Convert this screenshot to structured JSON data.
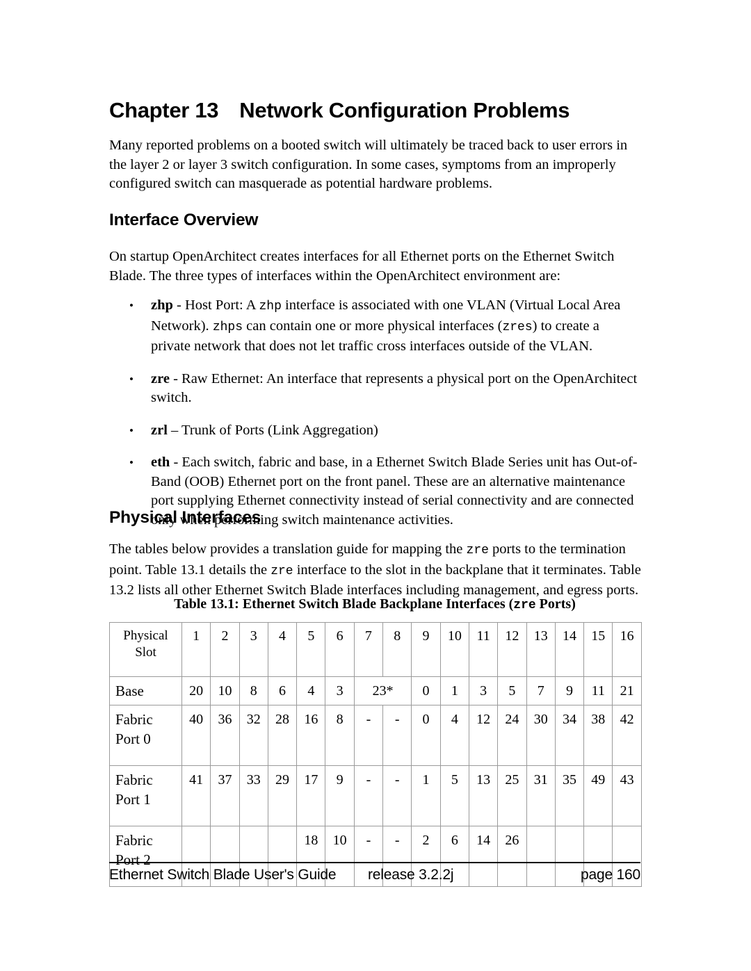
{
  "document": {
    "chapter_number": "Chapter 13",
    "chapter_title": "Network Configuration Problems",
    "intro_paragraph": "Many reported problems on a booted switch will ultimately be traced back to user errors in the layer 2 or layer 3 switch configuration. In some cases, symptoms from an improperly configured switch can masquerade as potential hardware problems."
  },
  "sections": {
    "interface_overview": {
      "heading": "Interface Overview",
      "paragraph": "On startup OpenArchitect creates interfaces for all Ethernet ports on the Ethernet Switch Blade. The three types of interfaces within the OpenArchitect environment are:",
      "bullets": [
        {
          "marker": "•",
          "term": "zhp",
          "separator": " - ",
          "text_1": "Host Port: A ",
          "mono_1": "zhp",
          "text_2": " interface is associated with one VLAN (Virtual Local Area Network). ",
          "mono_2": "zhps",
          "text_3": " can contain one or more physical interfaces (",
          "mono_3": "zres",
          "text_4": ") to create a private network that does not let traffic cross interfaces outside of the VLAN."
        },
        {
          "marker": "•",
          "term": "zre",
          "separator": " - ",
          "text_1": "Raw Ethernet: An interface that represents a physical port on the OpenArchitect switch."
        },
        {
          "marker": "•",
          "term": "zrl",
          "separator": " – ",
          "text_1": "Trunk of Ports (Link Aggregation)"
        },
        {
          "marker": "•",
          "term": "eth",
          "separator": " - ",
          "text_1": "Each switch, fabric and base, in a Ethernet Switch Blade Series unit has Out-of-Band (OOB) Ethernet port on the front panel. These are an alternative maintenance port supplying Ethernet connectivity instead of serial connectivity and are connected only when performing switch maintenance activities."
        }
      ]
    },
    "physical_interfaces": {
      "heading": "Physical Interfaces",
      "paragraph_1": "The tables below provides a translation guide for mapping the ",
      "paragraph_mono_1": "zre",
      "paragraph_2": " ports to the termination point. Table 13.1 details the ",
      "paragraph_mono_2": "zre",
      "paragraph_3": " interface to the slot in the backplane that it terminates. Table 13.2  lists all other Ethernet Switch Blade interfaces including management, and egress ports."
    }
  },
  "table": {
    "caption_prefix": "Table 13.1: Ethernet Switch Blade Backplane Interfaces (",
    "caption_mono": "zre",
    "caption_suffix": " Ports)",
    "header_label_line1": "Physical",
    "header_label_line2": "Slot",
    "columns": [
      "1",
      "2",
      "3",
      "4",
      "5",
      "6",
      "7",
      "8",
      "9",
      "10",
      "11",
      "12",
      "13",
      "14",
      "15",
      "16"
    ],
    "rows": [
      {
        "label_line1": "Base",
        "label_line2": "",
        "cells": [
          {
            "value": "20",
            "span": 1
          },
          {
            "value": "10",
            "span": 1
          },
          {
            "value": "8",
            "span": 1
          },
          {
            "value": "6",
            "span": 1
          },
          {
            "value": "4",
            "span": 1
          },
          {
            "value": "3",
            "span": 1
          },
          {
            "value": "23*",
            "span": 2
          },
          {
            "value": "0",
            "span": 1
          },
          {
            "value": "1",
            "span": 1
          },
          {
            "value": "3",
            "span": 1
          },
          {
            "value": "5",
            "span": 1
          },
          {
            "value": "7",
            "span": 1
          },
          {
            "value": "9",
            "span": 1
          },
          {
            "value": "11",
            "span": 1
          },
          {
            "value": "21",
            "span": 1
          }
        ]
      },
      {
        "label_line1": "Fabric",
        "label_line2": "Port 0",
        "cells": [
          {
            "value": "40",
            "span": 1
          },
          {
            "value": "36",
            "span": 1
          },
          {
            "value": "32",
            "span": 1
          },
          {
            "value": "28",
            "span": 1
          },
          {
            "value": "16",
            "span": 1
          },
          {
            "value": "8",
            "span": 1
          },
          {
            "value": "-",
            "span": 1
          },
          {
            "value": "-",
            "span": 1
          },
          {
            "value": "0",
            "span": 1
          },
          {
            "value": "4",
            "span": 1
          },
          {
            "value": "12",
            "span": 1
          },
          {
            "value": "24",
            "span": 1
          },
          {
            "value": "30",
            "span": 1
          },
          {
            "value": "34",
            "span": 1
          },
          {
            "value": "38",
            "span": 1
          },
          {
            "value": "42",
            "span": 1
          }
        ]
      },
      {
        "label_line1": "Fabric",
        "label_line2": "Port 1",
        "cells": [
          {
            "value": "41",
            "span": 1
          },
          {
            "value": "37",
            "span": 1
          },
          {
            "value": "33",
            "span": 1
          },
          {
            "value": "29",
            "span": 1
          },
          {
            "value": "17",
            "span": 1
          },
          {
            "value": "9",
            "span": 1
          },
          {
            "value": "-",
            "span": 1
          },
          {
            "value": "-",
            "span": 1
          },
          {
            "value": "1",
            "span": 1
          },
          {
            "value": "5",
            "span": 1
          },
          {
            "value": "13",
            "span": 1
          },
          {
            "value": "25",
            "span": 1
          },
          {
            "value": "31",
            "span": 1
          },
          {
            "value": "35",
            "span": 1
          },
          {
            "value": "49",
            "span": 1
          },
          {
            "value": "43",
            "span": 1
          }
        ]
      },
      {
        "label_line1": "Fabric",
        "label_line2": "Port 2",
        "cells": [
          {
            "value": "",
            "span": 1
          },
          {
            "value": "",
            "span": 1
          },
          {
            "value": "",
            "span": 1
          },
          {
            "value": "",
            "span": 1
          },
          {
            "value": "18",
            "span": 1
          },
          {
            "value": "10",
            "span": 1
          },
          {
            "value": "-",
            "span": 1
          },
          {
            "value": "-",
            "span": 1
          },
          {
            "value": "2",
            "span": 1
          },
          {
            "value": "6",
            "span": 1
          },
          {
            "value": "14",
            "span": 1
          },
          {
            "value": "26",
            "span": 1
          },
          {
            "value": "",
            "span": 1
          },
          {
            "value": "",
            "span": 1
          },
          {
            "value": "",
            "span": 1
          },
          {
            "value": "",
            "span": 1
          }
        ]
      }
    ]
  },
  "footer": {
    "guide": "Ethernet Switch Blade User's Guide",
    "release": "release  3.2.2j",
    "page": "page 160"
  }
}
